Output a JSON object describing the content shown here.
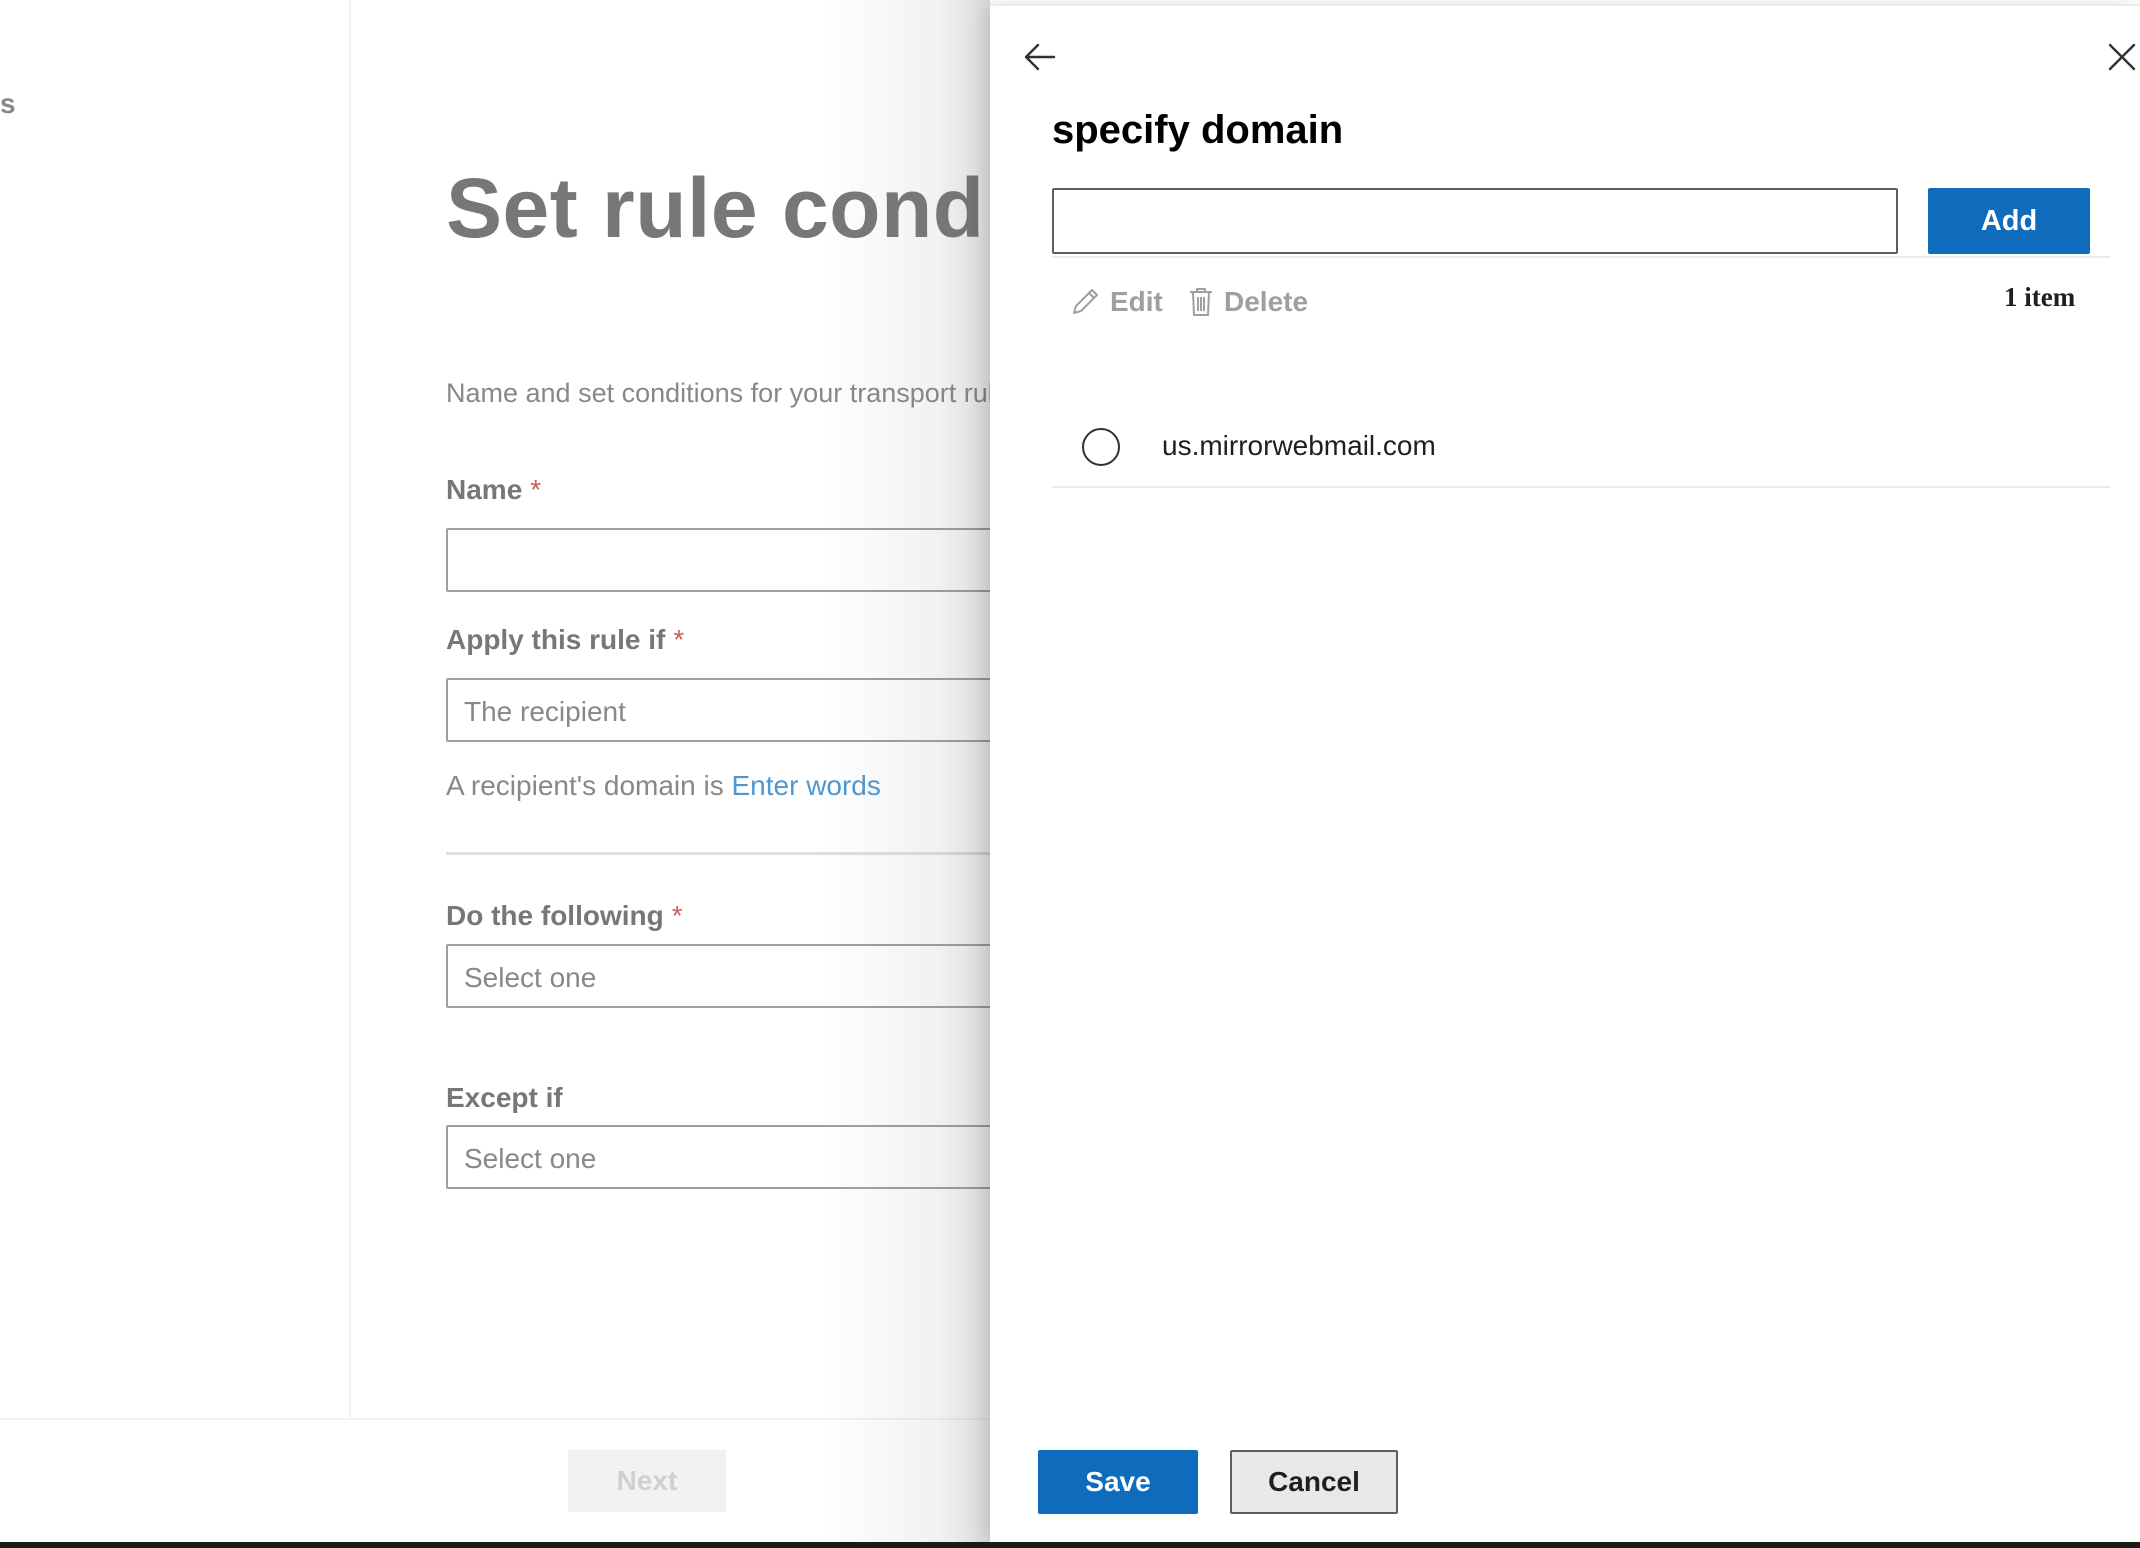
{
  "background": {
    "nav_stub": "s",
    "title": "Set rule conditions",
    "description": "Name and set conditions for your transport rule.",
    "fields": {
      "name_label": "Name",
      "apply_label": "Apply this rule if",
      "apply_value": "The recipient",
      "condition_prefix": "A recipient's domain is",
      "condition_link": "Enter words",
      "do_label": "Do the following",
      "do_value": "Select one",
      "except_label": "Except if",
      "except_value": "Select one",
      "required_marker": "*"
    },
    "next_label": "Next"
  },
  "panel": {
    "title": "specify domain",
    "input": {
      "value": "",
      "placeholder": ""
    },
    "add_label": "Add",
    "toolbar": {
      "edit_label": "Edit",
      "delete_label": "Delete",
      "item_count": "1 item"
    },
    "items": [
      {
        "label": "us.mirrorwebmail.com",
        "selected": false
      }
    ],
    "save_label": "Save",
    "cancel_label": "Cancel"
  },
  "icons": {
    "back": "arrow-left-icon",
    "close": "close-icon",
    "edit": "pencil-icon",
    "delete": "trash-icon"
  },
  "colors": {
    "primary": "#0f6cbd",
    "link": "#4e97d1",
    "required": "#c5605a",
    "disabled_text": "#a19f9d"
  }
}
